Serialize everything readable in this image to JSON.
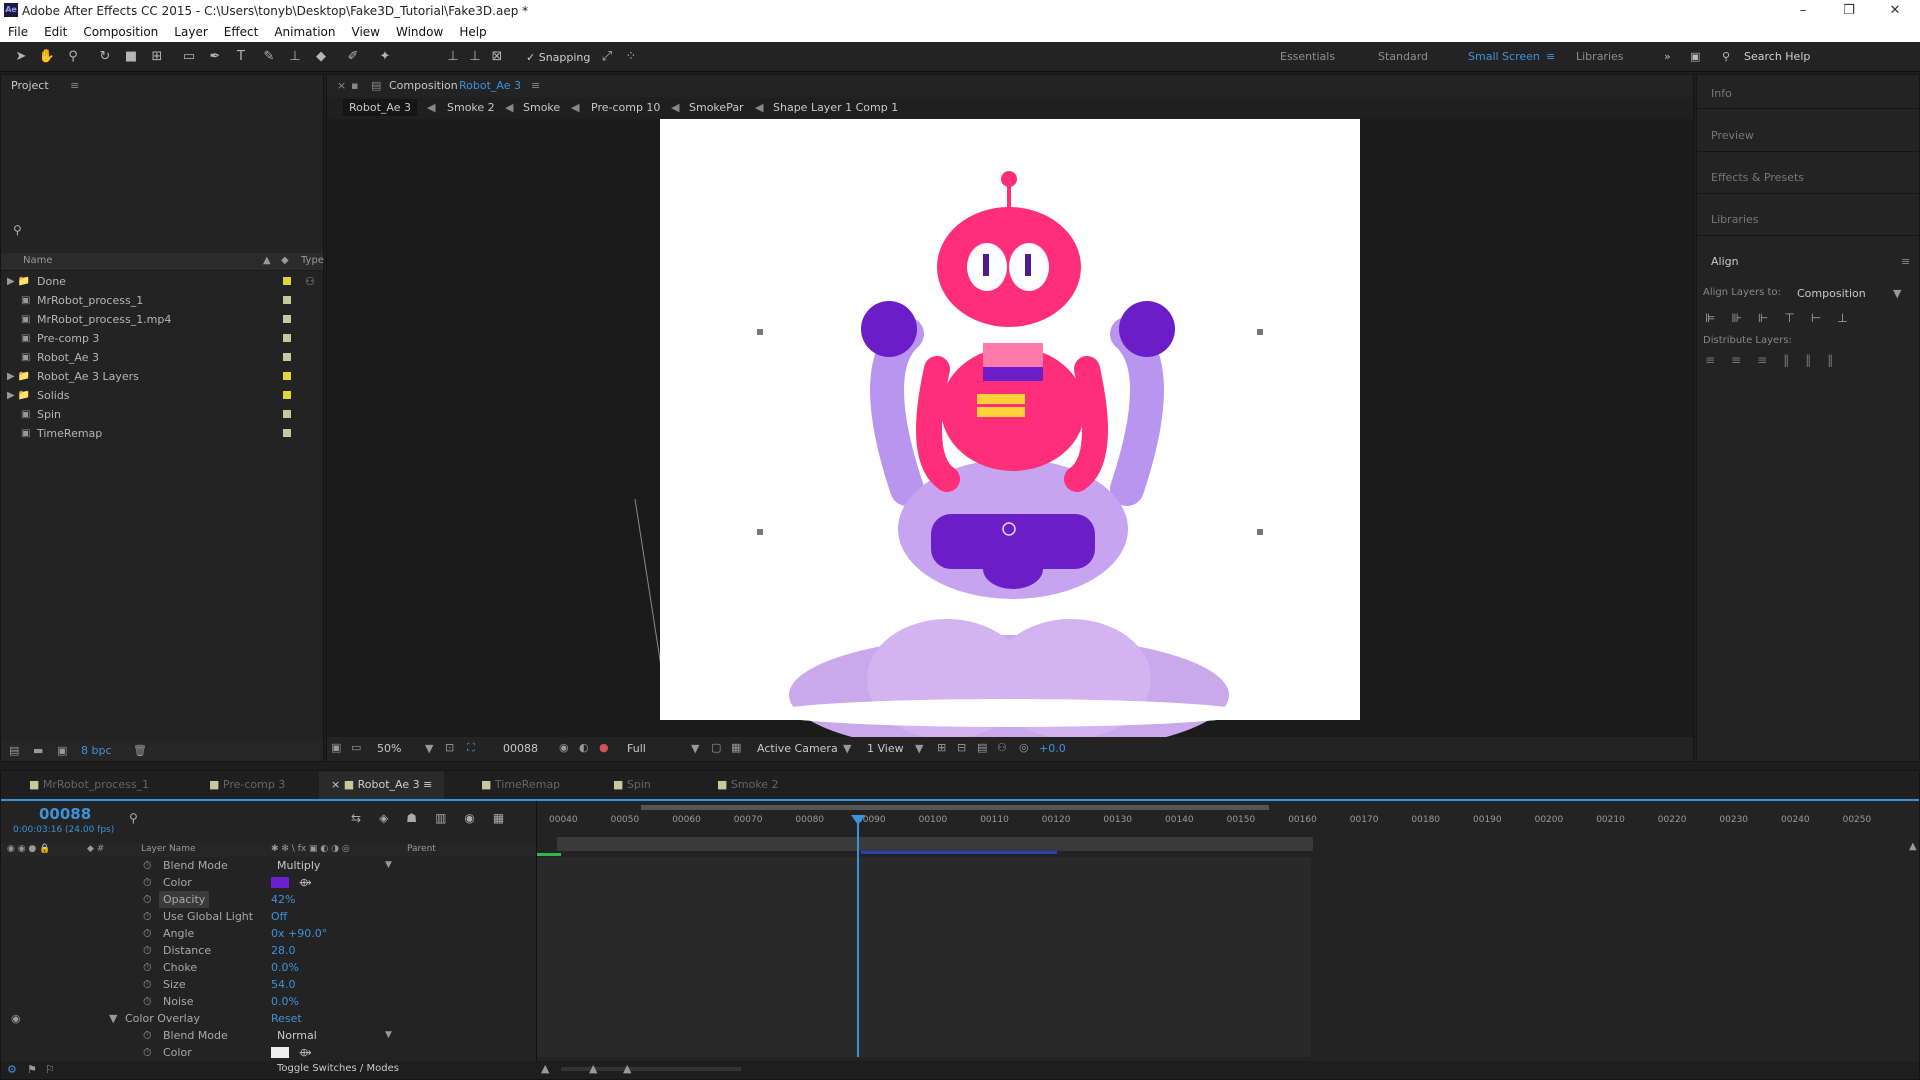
{
  "app": {
    "title": "Adobe After Effects CC 2015 - C:\\Users\\tonyb\\Desktop\\Fake3D_Tutorial\\Fake3D.aep *"
  },
  "window_controls": {
    "minimize": "–",
    "restore": "❐",
    "close": "✕"
  },
  "menu": [
    "File",
    "Edit",
    "Composition",
    "Layer",
    "Effect",
    "Animation",
    "View",
    "Window",
    "Help"
  ],
  "toolbar": {
    "snapping": "Snapping",
    "workspaces": [
      "Essentials",
      "Standard",
      "Small Screen",
      "Libraries"
    ],
    "active_workspace": "Small Screen",
    "search": "Search Help"
  },
  "project": {
    "title": "Project",
    "col_name": "Name",
    "col_type": "Type",
    "bpc": "8 bpc",
    "items": [
      {
        "name": "Done",
        "kind": "folder",
        "color": "#e0d53a"
      },
      {
        "name": "MrRobot_process_1",
        "kind": "comp",
        "color": "#c9c7a0"
      },
      {
        "name": "MrRobot_process_1.mp4",
        "kind": "footage",
        "color": "#c9c7a0"
      },
      {
        "name": "Pre-comp 3",
        "kind": "comp",
        "color": "#c9c7a0"
      },
      {
        "name": "Robot_Ae 3",
        "kind": "comp",
        "color": "#c9c7a0"
      },
      {
        "name": "Robot_Ae 3 Layers",
        "kind": "folder",
        "color": "#e0d53a"
      },
      {
        "name": "Solids",
        "kind": "folder",
        "color": "#e0d53a"
      },
      {
        "name": "Spin",
        "kind": "comp",
        "color": "#c9c7a0"
      },
      {
        "name": "TimeRemap",
        "kind": "comp",
        "color": "#c9c7a0"
      }
    ]
  },
  "composition": {
    "label": "Composition",
    "name": "Robot_Ae 3",
    "breadcrumbs": [
      "Robot_Ae 3",
      "Smoke 2",
      "Smoke",
      "Pre-comp 10",
      "SmokePar",
      "Shape Layer 1 Comp 1"
    ],
    "footer": {
      "zoom": "50%",
      "frame": "00088",
      "resolution": "Full",
      "camera": "Active Camera",
      "views": "1 View",
      "exposure": "+0.0"
    }
  },
  "right_panels": {
    "items": [
      "Info",
      "Preview",
      "Effects & Presets",
      "Libraries"
    ],
    "align": {
      "title": "Align",
      "align_to_label": "Align Layers to:",
      "align_to_value": "Composition",
      "distribute_label": "Distribute Layers:"
    }
  },
  "timeline": {
    "tabs": [
      "MrRobot_process_1",
      "Pre-comp 3",
      "Robot_Ae 3",
      "TimeRemap",
      "Spin",
      "Smoke 2"
    ],
    "active_tab": "Robot_Ae 3",
    "current_frame": "00088",
    "timecode": "0:00:03:16 (24.00 fps)",
    "col_layer_name": "Layer Name",
    "col_parent": "Parent",
    "ruler": [
      "00040",
      "00050",
      "00060",
      "00070",
      "00080",
      "00090",
      "00100",
      "00110",
      "00120",
      "00130",
      "00140",
      "00150",
      "00160",
      "00170",
      "00180",
      "00190",
      "00200",
      "00210",
      "00220",
      "00230",
      "00240",
      "00250"
    ],
    "properties": [
      {
        "name": "Blend Mode",
        "value": "Multiply",
        "type": "dropdown"
      },
      {
        "name": "Color",
        "value": "",
        "type": "color",
        "color": "#6a1fd0"
      },
      {
        "name": "Opacity",
        "value": "42%",
        "type": "num",
        "highlight": true
      },
      {
        "name": "Use Global Light",
        "value": "Off",
        "type": "num"
      },
      {
        "name": "Angle",
        "value": "0x +90.0°",
        "type": "num"
      },
      {
        "name": "Distance",
        "value": "28.0",
        "type": "num"
      },
      {
        "name": "Choke",
        "value": "0.0%",
        "type": "num"
      },
      {
        "name": "Size",
        "value": "54.0",
        "type": "num"
      },
      {
        "name": "Noise",
        "value": "0.0%",
        "type": "num"
      },
      {
        "name": "Color Overlay",
        "value": "Reset",
        "type": "group"
      },
      {
        "name": "Blend Mode",
        "value": "Normal",
        "type": "dropdown"
      },
      {
        "name": "Color",
        "value": "",
        "type": "color",
        "color": "#eeeeee"
      }
    ],
    "toggle_label": "Toggle Switches / Modes"
  }
}
